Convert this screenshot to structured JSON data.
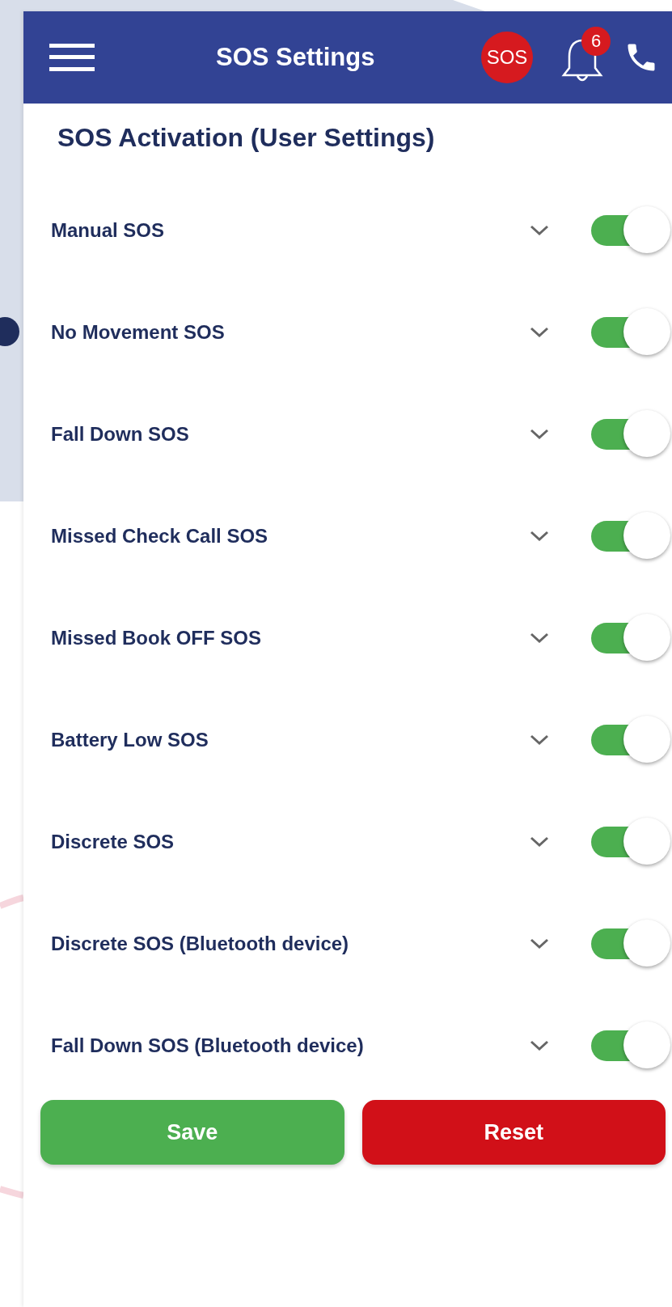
{
  "header": {
    "title": "SOS Settings",
    "sos_badge": "SOS",
    "notification_count": "6"
  },
  "section_title": "SOS Activation (User Settings)",
  "settings": [
    {
      "label": "Manual SOS",
      "on": true,
      "expanded": false
    },
    {
      "label": "No Movement SOS",
      "on": true,
      "expanded": false
    },
    {
      "label": "Fall Down SOS",
      "on": true,
      "expanded": false
    },
    {
      "label": "Missed Check Call SOS",
      "on": true,
      "expanded": false
    },
    {
      "label": "Missed Book OFF SOS",
      "on": true,
      "expanded": false
    },
    {
      "label": "Battery Low SOS",
      "on": true,
      "expanded": false
    },
    {
      "label": "Discrete SOS",
      "on": true,
      "expanded": false
    },
    {
      "label": "Discrete SOS (Bluetooth device)",
      "on": true,
      "expanded": false
    },
    {
      "label": "Fall Down SOS (Bluetooth device)",
      "on": true,
      "expanded": false
    }
  ],
  "buttons": [
    {
      "label": "Save",
      "kind": "save"
    },
    {
      "label": "Reset",
      "kind": "reset"
    }
  ]
}
